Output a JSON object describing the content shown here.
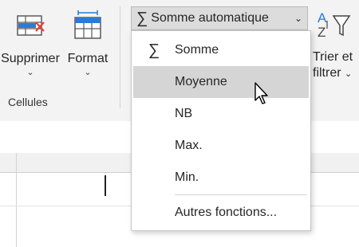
{
  "ribbon": {
    "delete_button": {
      "label": "Supprimer"
    },
    "format_button": {
      "label": "Format"
    },
    "cells_group_label": "Cellules",
    "autosum_button": {
      "label": "Somme automatique"
    },
    "sort_filter_button": {
      "label_line1": "Trier et",
      "label_line2": "filtrer"
    }
  },
  "autosum_menu": {
    "items": [
      {
        "label": "Somme",
        "icon": "sigma-icon"
      },
      {
        "label": "Moyenne"
      },
      {
        "label": "NB"
      },
      {
        "label": "Max."
      },
      {
        "label": "Min."
      },
      {
        "label": "Autres fonctions..."
      }
    ],
    "hovered_item": "Moyenne"
  },
  "colors": {
    "ribbon_bg": "#f3f3f3",
    "menu_hover": "#d5d5d5",
    "icon_blue": "#2b7bd6",
    "icon_red": "#e0413b"
  }
}
